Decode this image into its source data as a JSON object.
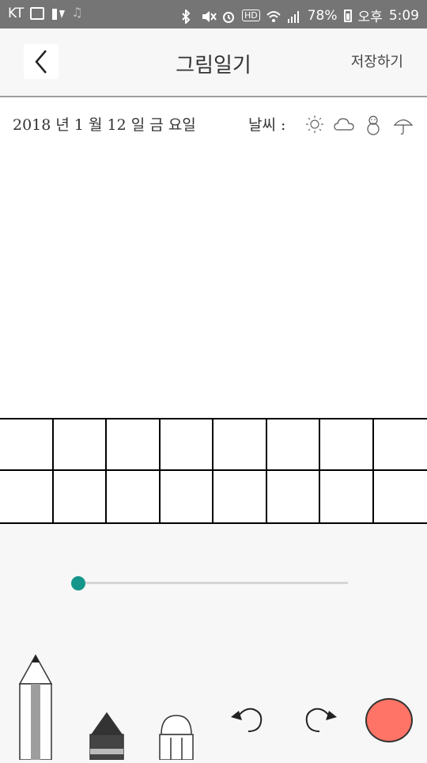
{
  "status_bar": {
    "carrier": "KT",
    "battery_percent": "78%",
    "am_pm": "오후",
    "time": "5:09",
    "hd_badge": "HD"
  },
  "app_bar": {
    "title": "그림일기",
    "save_label": "저장하기"
  },
  "diary": {
    "date_text": "2018 년 1 월 12 일 금 요일",
    "weather_label": "날씨 :",
    "weather_icons": [
      "sun-icon",
      "cloud-icon",
      "snowman-icon",
      "umbrella-icon"
    ]
  },
  "writing_grid": {
    "columns": 8,
    "rows": 2
  },
  "brush_size_slider": {
    "value": 0
  },
  "tools": [
    "pencil-icon",
    "crayon-icon",
    "eraser-icon",
    "undo-icon",
    "redo-icon"
  ],
  "current_color": "#ff7466",
  "colors": {
    "accent": "#16968a",
    "status_bar_bg": "#757575"
  }
}
